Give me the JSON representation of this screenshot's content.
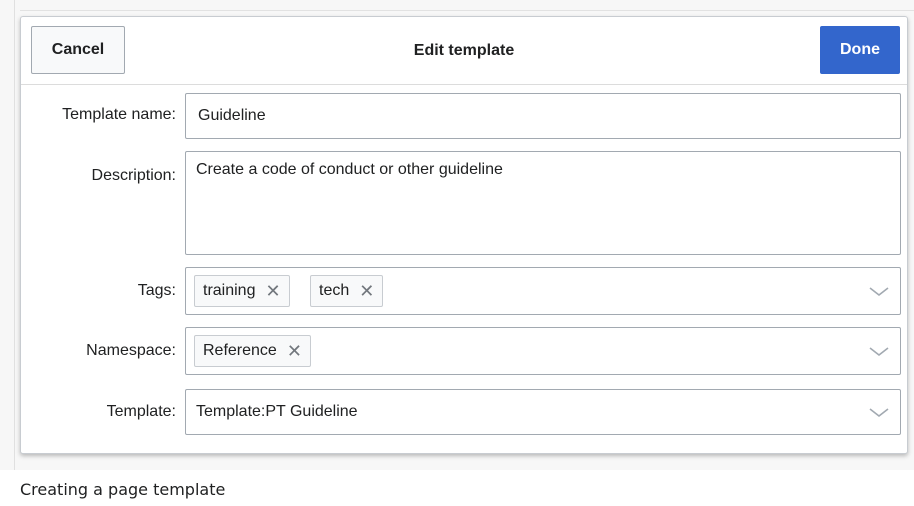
{
  "dialog": {
    "title": "Edit template",
    "cancel_label": "Cancel",
    "done_label": "Done",
    "accent_color": "#3366cc"
  },
  "fields": {
    "name": {
      "label": "Template name:",
      "value": "Guideline"
    },
    "description": {
      "label": "Description:",
      "value": "Create a code of conduct or other guideline"
    },
    "tags": {
      "label": "Tags:",
      "items": [
        "training",
        "tech"
      ]
    },
    "namespace": {
      "label": "Namespace:",
      "items": [
        "Reference"
      ]
    },
    "template": {
      "label": "Template:",
      "value": "Template:PT Guideline"
    }
  },
  "icons": {
    "remove": "close-icon",
    "dropdown": "chevron-down-icon"
  },
  "caption": "Creating a page template"
}
